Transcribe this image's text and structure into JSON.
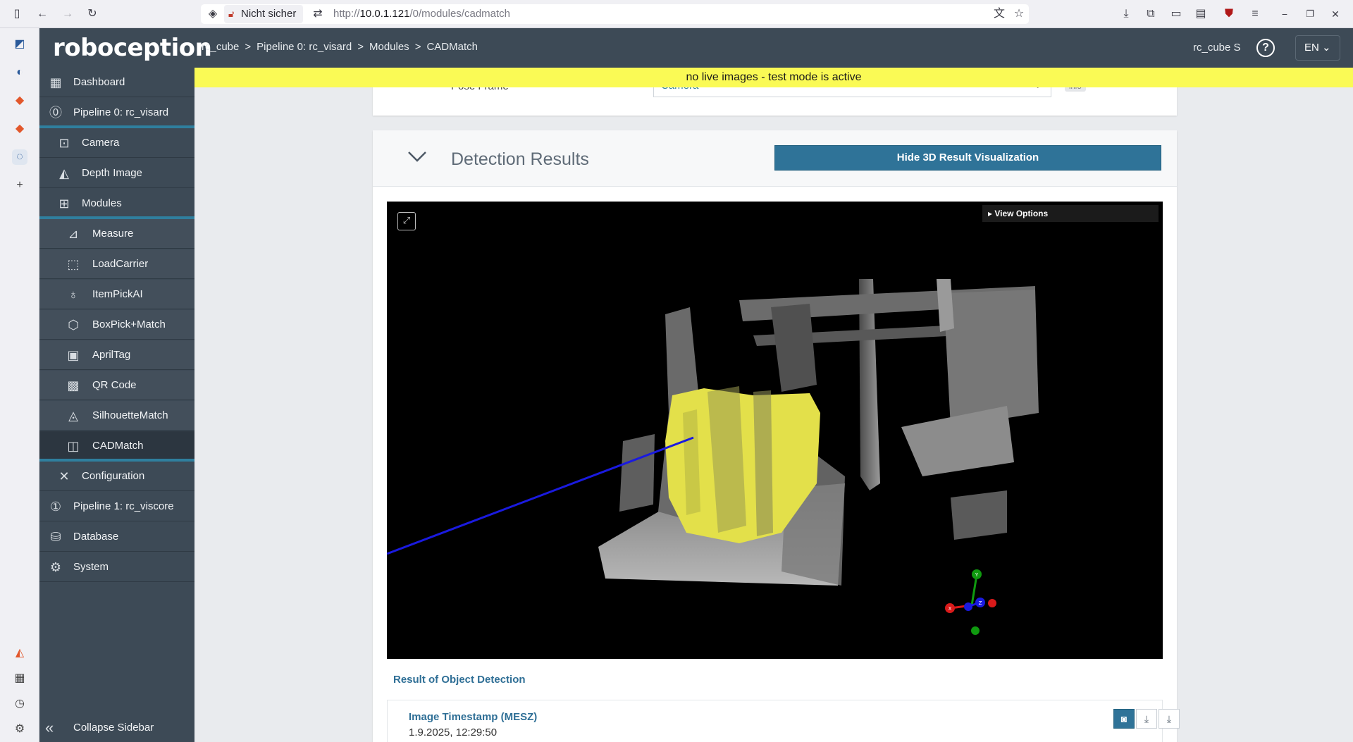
{
  "browser": {
    "security_label": "Nicht sicher",
    "url_prefix": "http://",
    "url_host": "10.0.1.121",
    "url_path": "/0/modules/cadmatch"
  },
  "header": {
    "logo": "roboception",
    "breadcrumb": [
      "rc_cube",
      "Pipeline 0: rc_visard",
      "Modules",
      "CADMatch"
    ],
    "device": "rc_cube S",
    "help": "?",
    "language": "EN"
  },
  "banner": "no live images - test mode is active",
  "sidebar": {
    "items": [
      {
        "label": "Dashboard",
        "icon": "dashboard-icon"
      },
      {
        "label": "Pipeline 0: rc_visard",
        "icon": "pipeline-0-icon"
      },
      {
        "label": "Camera",
        "icon": "camera-icon"
      },
      {
        "label": "Depth Image",
        "icon": "depth-image-icon"
      },
      {
        "label": "Modules",
        "icon": "modules-icon"
      },
      {
        "label": "Measure",
        "icon": "measure-icon"
      },
      {
        "label": "LoadCarrier",
        "icon": "loadcarrier-icon"
      },
      {
        "label": "ItemPickAI",
        "icon": "itempickai-icon"
      },
      {
        "label": "BoxPick+Match",
        "icon": "boxpick-icon"
      },
      {
        "label": "AprilTag",
        "icon": "apriltag-icon"
      },
      {
        "label": "QR Code",
        "icon": "qr-code-icon"
      },
      {
        "label": "SilhouetteMatch",
        "icon": "silhouettematch-icon"
      },
      {
        "label": "CADMatch",
        "icon": "cadmatch-icon"
      },
      {
        "label": "Configuration",
        "icon": "configuration-icon"
      },
      {
        "label": "Pipeline 1: rc_viscore",
        "icon": "pipeline-1-icon"
      },
      {
        "label": "Database",
        "icon": "database-icon"
      },
      {
        "label": "System",
        "icon": "system-gear-icon"
      }
    ],
    "collapse": "Collapse Sidebar"
  },
  "pose_frame": {
    "label": "Pose Frame",
    "value": "Camera",
    "info": "info"
  },
  "detection": {
    "title": "Detection Results",
    "hide_button": "Hide 3D Result Visualization",
    "view_options": "View Options",
    "result_heading": "Result of Object Detection",
    "timestamp_label": "Image Timestamp (MESZ)",
    "timestamp_value": "1.9.2025, 12:29:50"
  },
  "axes": {
    "x": "X",
    "y": "Y",
    "z": "Z"
  },
  "colors": {
    "header_bg": "#3d4a56",
    "accent": "#2f7398",
    "banner": "#fafa55",
    "match_yellow": "#e3e04a"
  }
}
